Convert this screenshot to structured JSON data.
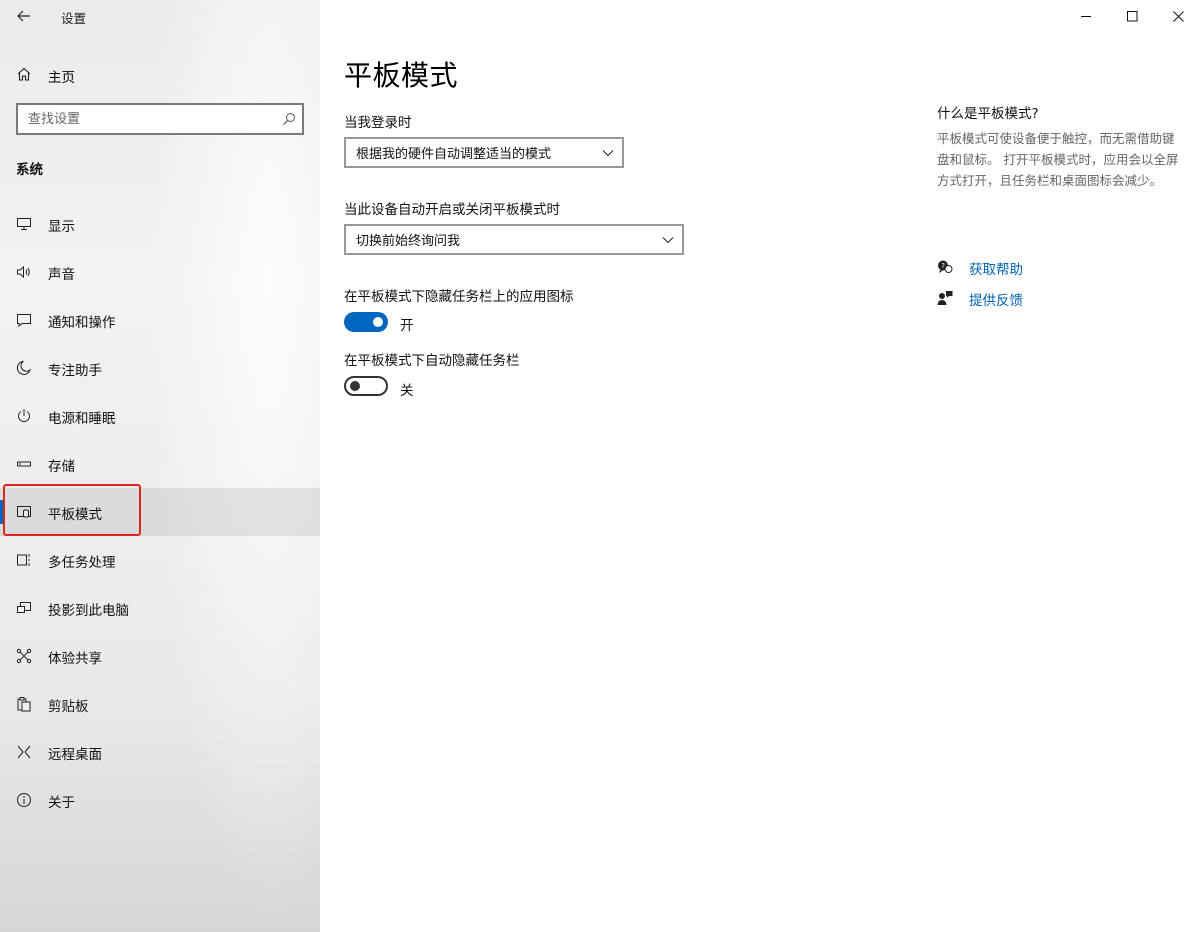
{
  "window": {
    "title": "设置"
  },
  "sidebar": {
    "home_label": "主页",
    "search_placeholder": "查找设置",
    "section_title": "系统",
    "items": [
      {
        "label": "显示",
        "icon": "monitor-icon"
      },
      {
        "label": "声音",
        "icon": "speaker-icon"
      },
      {
        "label": "通知和操作",
        "icon": "notification-icon"
      },
      {
        "label": "专注助手",
        "icon": "moon-icon"
      },
      {
        "label": "电源和睡眠",
        "icon": "power-icon"
      },
      {
        "label": "存储",
        "icon": "storage-icon"
      },
      {
        "label": "平板模式",
        "icon": "tablet-mode-icon",
        "active": true
      },
      {
        "label": "多任务处理",
        "icon": "multitasking-icon"
      },
      {
        "label": "投影到此电脑",
        "icon": "projection-icon"
      },
      {
        "label": "体验共享",
        "icon": "share-icon"
      },
      {
        "label": "剪贴板",
        "icon": "clipboard-icon"
      },
      {
        "label": "远程桌面",
        "icon": "remote-desktop-icon"
      },
      {
        "label": "关于",
        "icon": "info-icon"
      }
    ]
  },
  "main": {
    "page_title": "平板模式",
    "signin_label": "当我登录时",
    "signin_value": "根据我的硬件自动调整适当的模式",
    "switch_label": "当此设备自动开启或关闭平板模式时",
    "switch_value": "切换前始终询问我",
    "hide_icons_label": "在平板模式下隐藏任务栏上的应用图标",
    "hide_icons_state": "开",
    "hide_icons_on": true,
    "autohide_label": "在平板模式下自动隐藏任务栏",
    "autohide_state": "关",
    "autohide_on": false
  },
  "help": {
    "title": "什么是平板模式?",
    "description": "平板模式可使设备便于触控，而无需借助键盘和鼠标。 打开平板模式时，应用会以全屏方式打开，且任务栏和桌面图标会减少。",
    "get_help": "获取帮助",
    "feedback": "提供反馈"
  },
  "colors": {
    "accent": "#0067c0",
    "link": "#0063b1",
    "highlight": "#e3241b"
  }
}
